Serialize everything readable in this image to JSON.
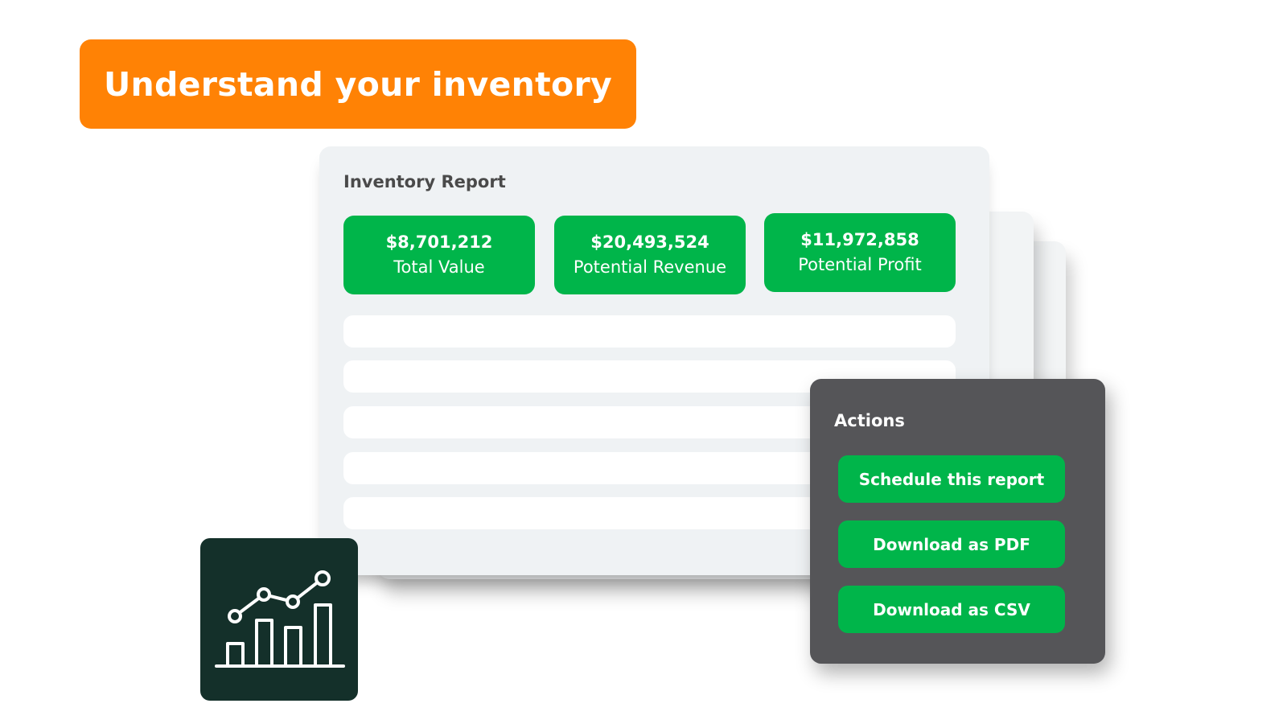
{
  "headline": {
    "text": "Understand your inventory",
    "color": "#ff8205"
  },
  "report": {
    "title": "Inventory Report",
    "metrics": [
      {
        "value": "$8,701,212",
        "label": "Total Value"
      },
      {
        "value": "$20,493,524",
        "label": "Potential Revenue"
      },
      {
        "value": "$11,972,858",
        "label": "Potential Profit"
      }
    ],
    "accent_color": "#00b54a"
  },
  "actions": {
    "title": "Actions",
    "buttons": [
      {
        "label": "Schedule this report"
      },
      {
        "label": "Download as PDF"
      },
      {
        "label": "Download as CSV"
      }
    ]
  },
  "icon_tile": {
    "icon": "growth-chart-icon",
    "background": "#14302a"
  }
}
